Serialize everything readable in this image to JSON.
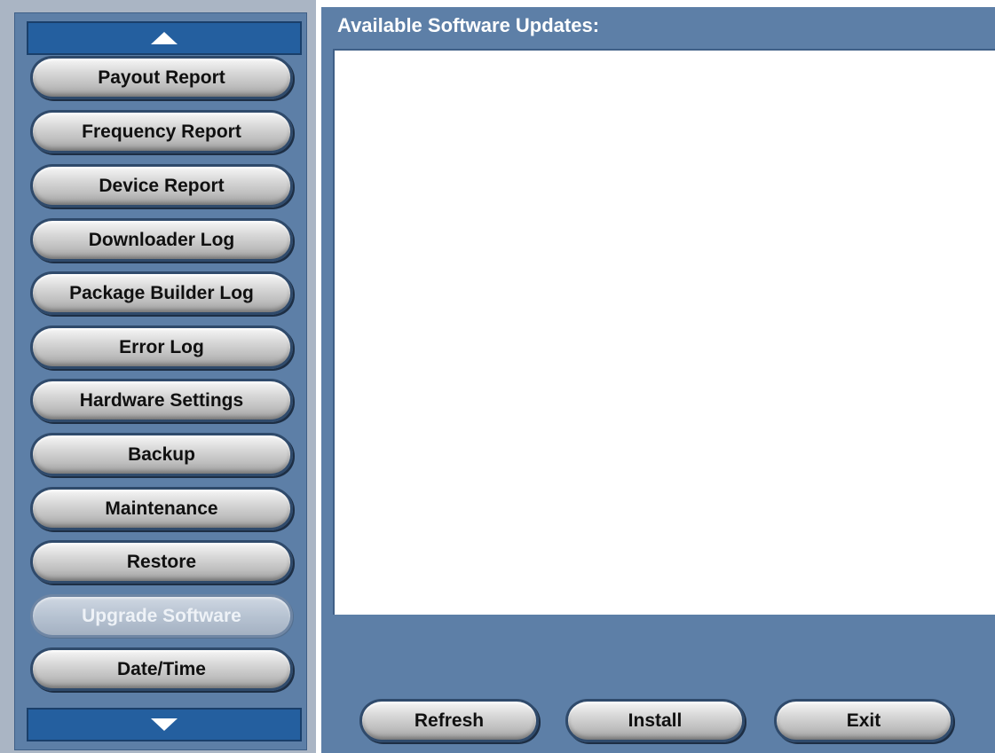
{
  "sidebar": {
    "scroll_up_icon": "triangle-up",
    "scroll_down_icon": "triangle-down",
    "items": [
      {
        "label": "Payout Report",
        "enabled": true
      },
      {
        "label": "Frequency Report",
        "enabled": true
      },
      {
        "label": "Device Report",
        "enabled": true
      },
      {
        "label": "Downloader Log",
        "enabled": true
      },
      {
        "label": "Package Builder Log",
        "enabled": true
      },
      {
        "label": "Error Log",
        "enabled": true
      },
      {
        "label": "Hardware Settings",
        "enabled": true
      },
      {
        "label": "Backup",
        "enabled": true
      },
      {
        "label": "Maintenance",
        "enabled": true
      },
      {
        "label": "Restore",
        "enabled": true
      },
      {
        "label": "Upgrade Software",
        "enabled": false
      },
      {
        "label": "Date/Time",
        "enabled": true
      }
    ]
  },
  "main": {
    "title": "Available Software Updates:",
    "updates": []
  },
  "actions": {
    "refresh_label": "Refresh",
    "install_label": "Install",
    "exit_label": "Exit"
  },
  "colors": {
    "panel_blue": "#5d7fa7",
    "scroll_button_blue": "#245f9f",
    "sidebar_border": "#aab5c4"
  }
}
